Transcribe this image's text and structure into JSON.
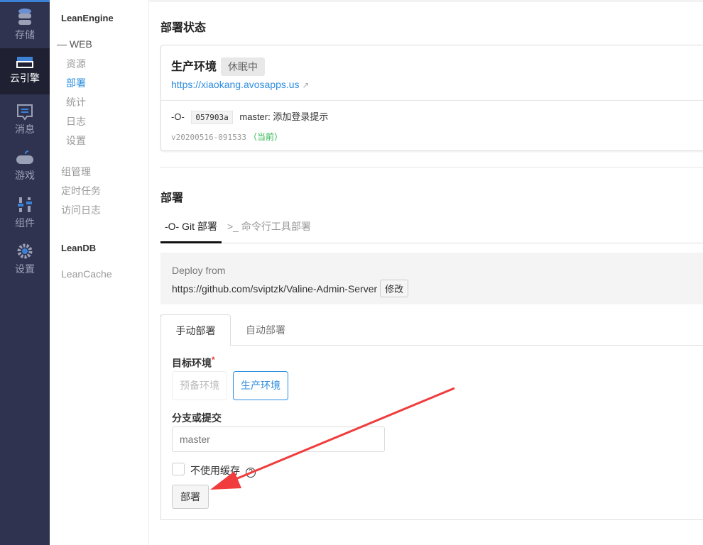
{
  "rail": [
    {
      "label": "存储",
      "icon": "database-icon"
    },
    {
      "label": "云引擎",
      "icon": "engine-icon"
    },
    {
      "label": "消息",
      "icon": "message-icon"
    },
    {
      "label": "游戏",
      "icon": "gamepad-icon"
    },
    {
      "label": "组件",
      "icon": "components-icon"
    },
    {
      "label": "设置",
      "icon": "gear-icon"
    }
  ],
  "sub": {
    "leanengine": "LeanEngine",
    "web": "WEB",
    "web_items": [
      "资源",
      "部署",
      "统计",
      "日志",
      "设置"
    ],
    "group": "组管理",
    "cron": "定时任务",
    "access": "访问日志",
    "leandb": "LeanDB",
    "leancache": "LeanCache"
  },
  "status": {
    "title": "部署状态",
    "env": "生产环境",
    "badge": "休眠中",
    "url": "https://xiaokang.avosapps.us",
    "commit": "057903a",
    "message": "master: 添加登录提示",
    "version": "v20200516-091533",
    "current": "（当前）"
  },
  "deploy": {
    "title": "部署",
    "tabs": [
      "Git 部署",
      "命令行工具部署"
    ],
    "from_label": "Deploy from",
    "repo": "https://github.com/sviptzk/Valine-Admin-Server",
    "edit": "修改",
    "subtabs": [
      "手动部署",
      "自动部署"
    ],
    "target_label": "目标环境",
    "required": "*",
    "envs": [
      "预备环境",
      "生产环境"
    ],
    "branch_label": "分支或提交",
    "branch_placeholder": "master",
    "nocache": "不使用缓存",
    "help": "?",
    "submit": "部署"
  },
  "colors": {
    "accent": "#2f8ee0",
    "rail": "#2f3350",
    "arrow": "#f03c3c",
    "green": "#2db54d"
  }
}
